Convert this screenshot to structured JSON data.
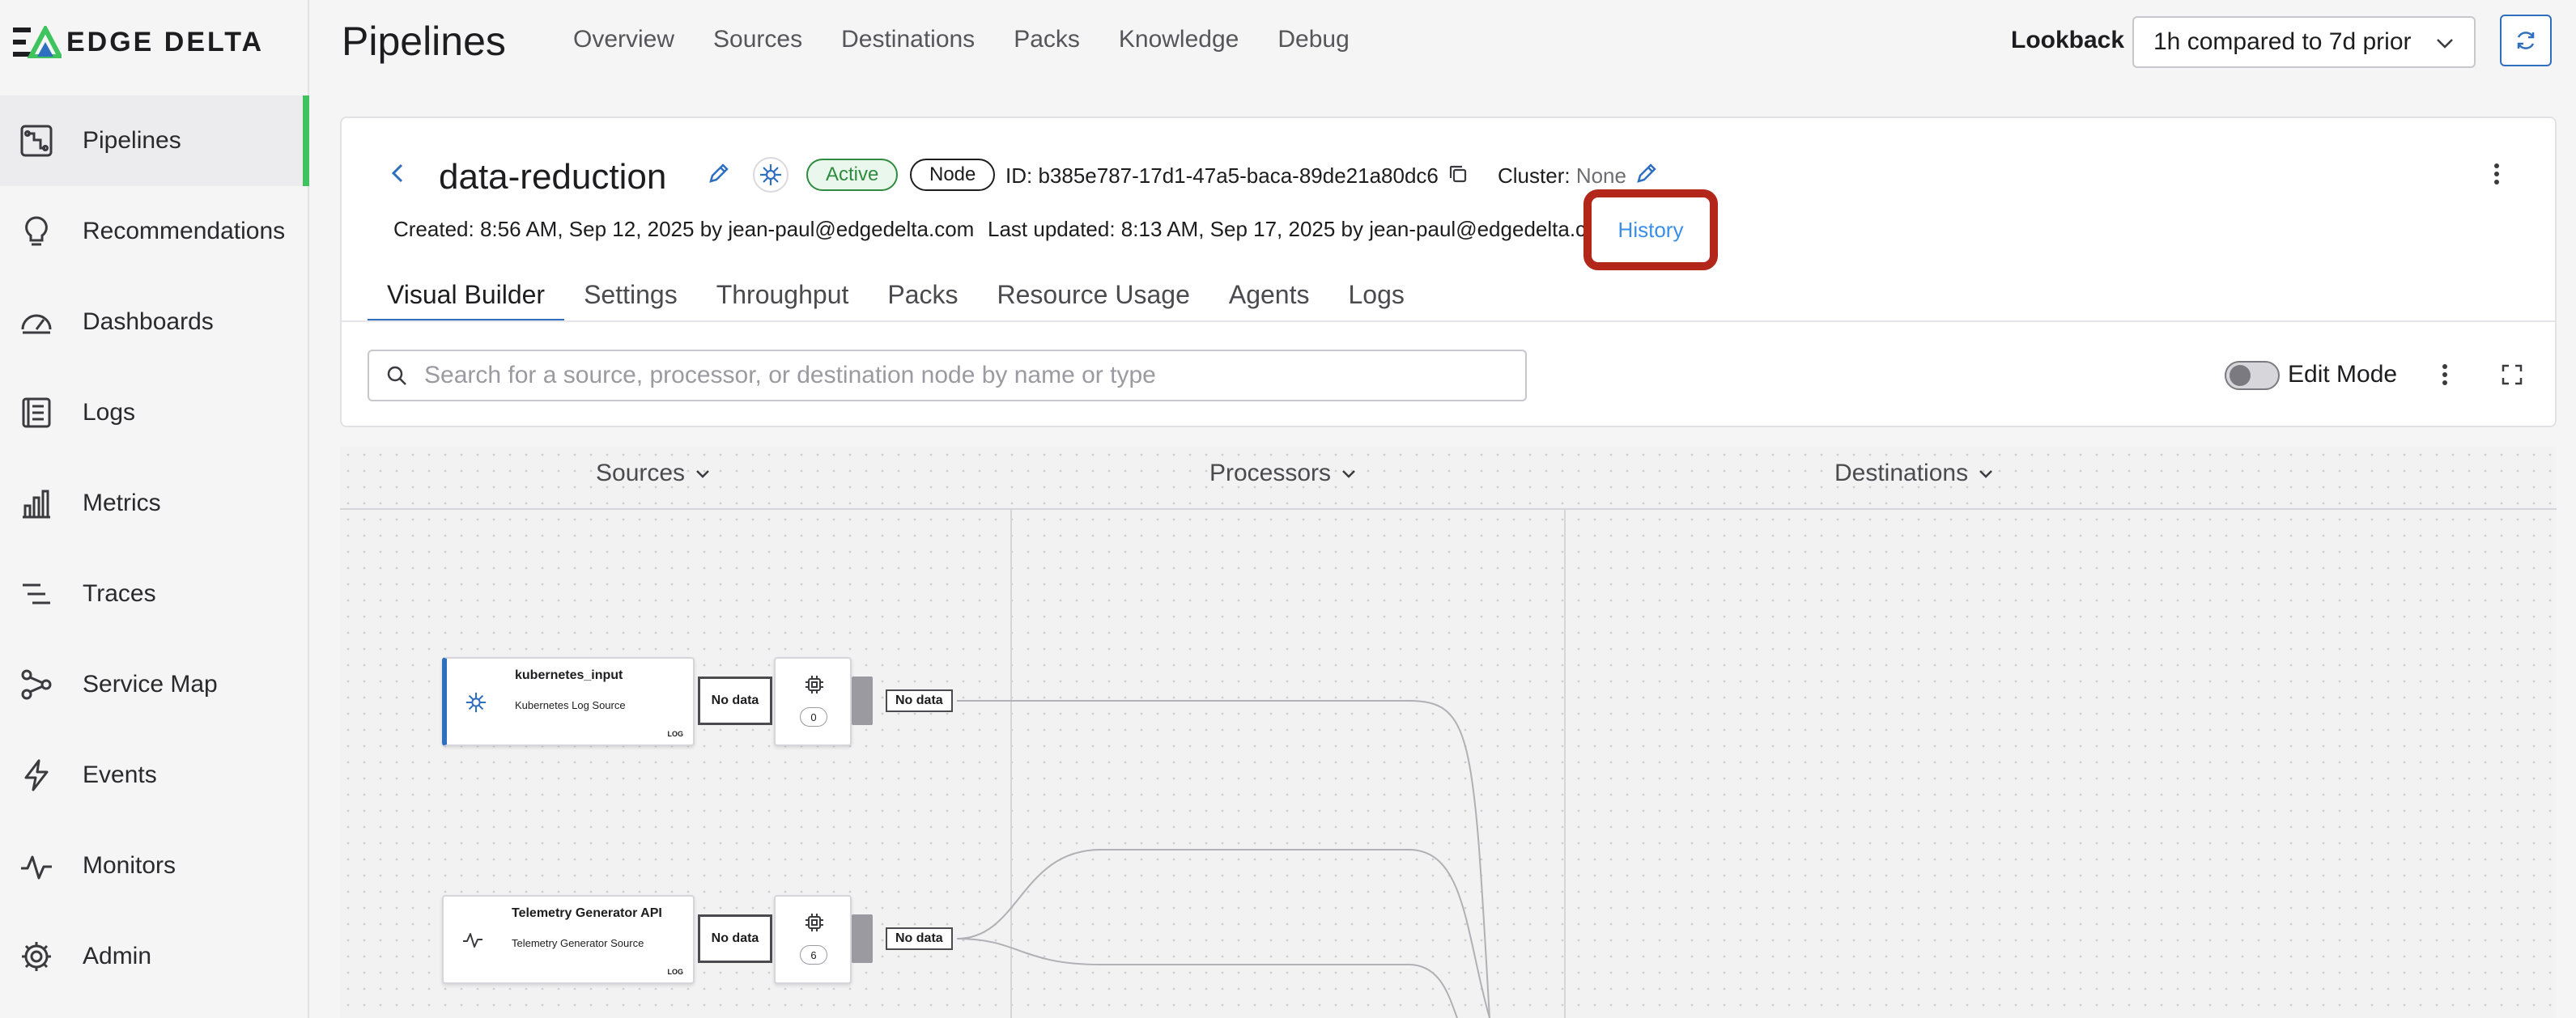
{
  "brand": {
    "logo_text": "EDGE DELTA"
  },
  "sidebar": {
    "items": [
      {
        "label": "Pipelines",
        "icon": "pipelines-icon",
        "active": true
      },
      {
        "label": "Recommendations",
        "icon": "lightbulb-icon",
        "active": false
      },
      {
        "label": "Dashboards",
        "icon": "gauge-icon",
        "active": false
      },
      {
        "label": "Logs",
        "icon": "logs-icon",
        "active": false
      },
      {
        "label": "Metrics",
        "icon": "bar-chart-icon",
        "active": false
      },
      {
        "label": "Traces",
        "icon": "traces-icon",
        "active": false
      },
      {
        "label": "Service Map",
        "icon": "network-icon",
        "active": false
      },
      {
        "label": "Events",
        "icon": "lightning-icon",
        "active": false
      },
      {
        "label": "Monitors",
        "icon": "pulse-icon",
        "active": false
      },
      {
        "label": "Admin",
        "icon": "gear-icon",
        "active": false
      }
    ]
  },
  "header": {
    "title": "Pipelines",
    "nav": [
      "Overview",
      "Sources",
      "Destinations",
      "Packs",
      "Knowledge",
      "Debug"
    ],
    "lookback_label": "Lookback",
    "lookback_value": "1h compared to 7d prior"
  },
  "pipeline": {
    "name": "data-reduction",
    "status": "Active",
    "type": "Node",
    "id_text": "ID: b385e787-17d1-47a5-baca-89de21a80dc6",
    "cluster_label": "Cluster:",
    "cluster_value": "None",
    "created": "Created: 8:56 AM, Sep 12, 2025 by jean-paul@edgedelta.com",
    "updated": "Last updated: 8:13 AM, Sep 17, 2025 by jean-paul@edgedelta.com",
    "history": "History"
  },
  "tabs": [
    {
      "label": "Visual Builder",
      "active": true
    },
    {
      "label": "Settings",
      "active": false
    },
    {
      "label": "Throughput",
      "active": false
    },
    {
      "label": "Packs",
      "active": false
    },
    {
      "label": "Resource Usage",
      "active": false
    },
    {
      "label": "Agents",
      "active": false
    },
    {
      "label": "Logs",
      "active": false
    }
  ],
  "toolbar": {
    "search_placeholder": "Search for a source, processor, or destination node by name or type",
    "edit_mode_label": "Edit Mode",
    "edit_mode_on": false
  },
  "canvas": {
    "columns": [
      "Sources",
      "Processors",
      "Destinations"
    ],
    "sources": [
      {
        "title": "kubernetes_input",
        "subtitle": "Kubernetes Log Source",
        "tag": "LOG",
        "status": "No data",
        "processors": "0",
        "edge_label": "No data"
      },
      {
        "title": "Telemetry Generator API",
        "subtitle": "Telemetry Generator Source",
        "tag": "LOG",
        "status": "No data",
        "processors": "6",
        "edge_label": "No data"
      }
    ]
  },
  "colors": {
    "accent_green": "#3fc35e",
    "active_badge": "#2e8b3e",
    "tab_underline": "#2f6fc0",
    "history_link": "#3a8ee6",
    "highlight_box": "#b3271a"
  }
}
